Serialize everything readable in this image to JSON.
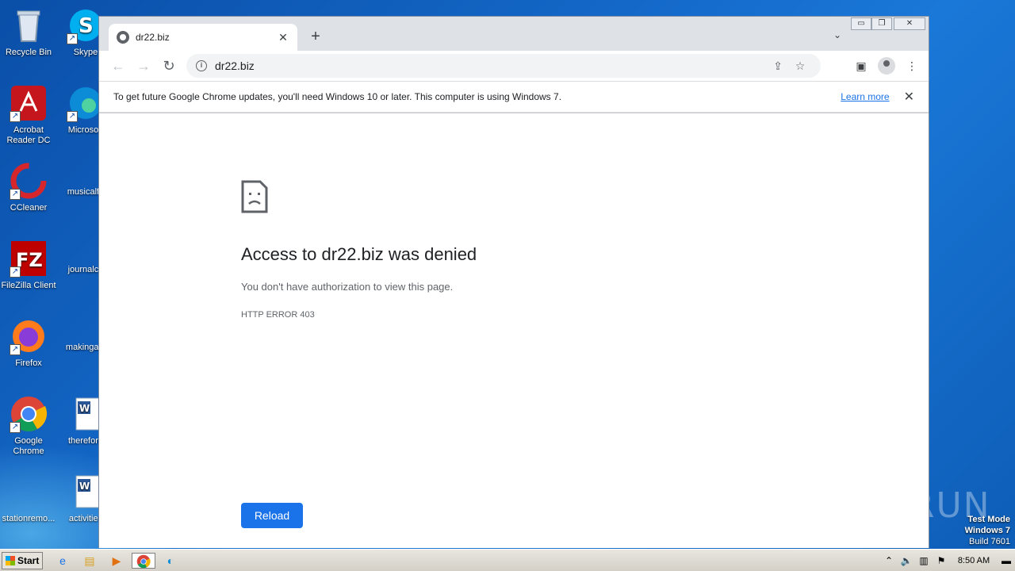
{
  "desktop": {
    "icons": [
      {
        "label": "Recycle Bin",
        "icon": "recycle-bin-icon"
      },
      {
        "label": "Skype",
        "icon": "skype-icon"
      },
      {
        "label": "Acrobat Reader DC",
        "icon": "acrobat-icon"
      },
      {
        "label": "Microsoft",
        "icon": "edge-icon"
      },
      {
        "label": "CCleaner",
        "icon": "ccleaner-icon"
      },
      {
        "label": "musicalfe",
        "icon": "file-icon"
      },
      {
        "label": "FileZilla Client",
        "icon": "filezilla-icon"
      },
      {
        "label": "journalco",
        "icon": "file-icon"
      },
      {
        "label": "Firefox",
        "icon": "firefox-icon"
      },
      {
        "label": "makingact",
        "icon": "file-icon"
      },
      {
        "label": "Google Chrome",
        "icon": "chrome-icon"
      },
      {
        "label": "therefore",
        "icon": "word-doc-icon"
      },
      {
        "label": "stationremo...",
        "icon": "file-icon"
      },
      {
        "label": "activities",
        "icon": "word-doc-icon"
      }
    ],
    "watermark": "ANY RUN",
    "test_mode": {
      "line1": "Test Mode",
      "line2": "Windows 7",
      "line3": "Build 7601"
    }
  },
  "browser": {
    "tab_title": "dr22.biz",
    "new_tab": "+",
    "url": "dr22.biz",
    "window_controls": {
      "minimize": "▭",
      "restore": "❐",
      "close": "✕"
    },
    "infobar": {
      "message": "To get future Google Chrome updates, you'll need Windows 10 or later. This computer is using Windows 7.",
      "link": "Learn more"
    },
    "error": {
      "title": "Access to dr22.biz was denied",
      "description": "You don't have authorization to view this page.",
      "code": "HTTP ERROR 403",
      "button": "Reload"
    }
  },
  "taskbar": {
    "start_label": "Start",
    "apps": [
      "ie-icon",
      "explorer-icon",
      "media-player-icon",
      "chrome-icon",
      "edge-icon"
    ],
    "clock": "8:50 AM"
  }
}
